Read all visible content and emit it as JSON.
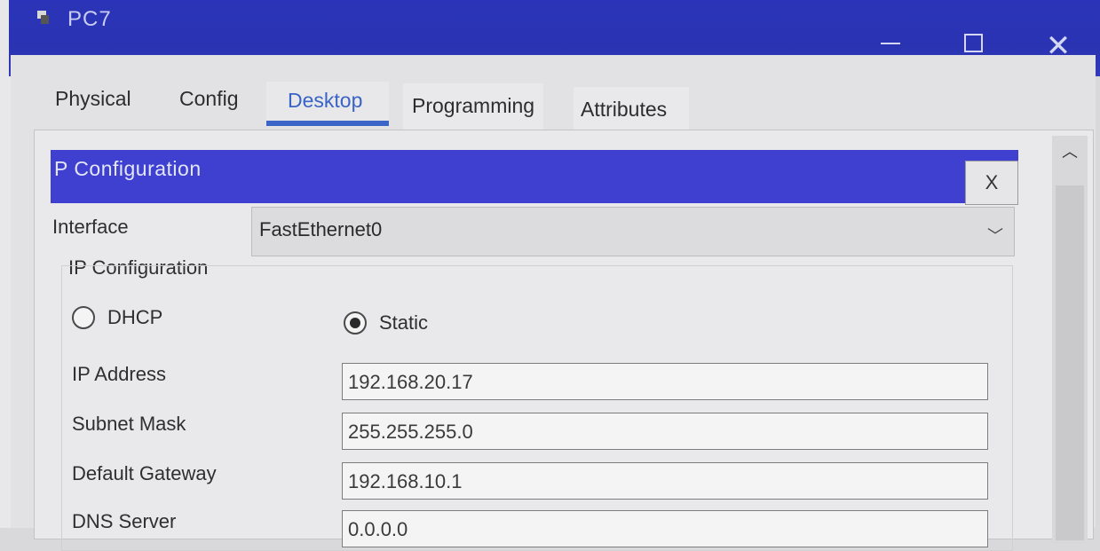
{
  "window": {
    "title": "PC7",
    "minimize": "—",
    "maximize": "☐",
    "close": "✕"
  },
  "tabs": [
    "Physical",
    "Config",
    "Desktop",
    "Programming",
    "Attributes"
  ],
  "active_tab": "Desktop",
  "ip_config": {
    "header": "P Configuration",
    "close_label": "X",
    "interface_label": "Interface",
    "interface_value": "FastEthernet0",
    "group_label": "IP Configuration",
    "dhcp_label": "DHCP",
    "static_label": "Static",
    "selected_mode": "Static",
    "fields": [
      {
        "label": "IP Address",
        "value": "192.168.20.17"
      },
      {
        "label": "Subnet Mask",
        "value": "255.255.255.0"
      },
      {
        "label": "Default Gateway",
        "value": "192.168.10.1"
      },
      {
        "label": "DNS Server",
        "value": "0.0.0.0"
      }
    ]
  },
  "icons": {
    "scroll_up": "chevron-up-icon",
    "dropdown": "chevron-down-icon"
  },
  "colors": {
    "titlebar": "#2b34b8",
    "header_bar": "#3f3fd0",
    "active_tab_accent": "#3b66c8"
  }
}
